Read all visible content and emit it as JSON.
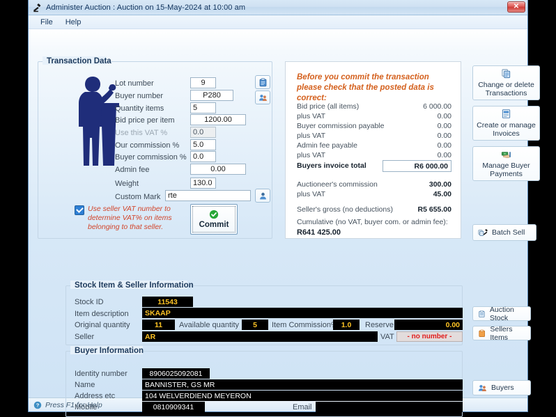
{
  "window": {
    "title": "Administer Auction : Auction on 15-May-2024 at 10:00 am",
    "icon": "gavel-icon",
    "close_label": "✕"
  },
  "menu": {
    "items": [
      {
        "label": "File"
      },
      {
        "label": "Help"
      }
    ]
  },
  "transaction": {
    "legend": "Transaction Data",
    "fields": [
      {
        "label": "Lot number",
        "value": "9",
        "align": "c",
        "disabled": false
      },
      {
        "label": "Buyer number",
        "value": "P280",
        "align": "c",
        "disabled": false
      },
      {
        "label": "Quantity items",
        "value": "5",
        "align": "l",
        "disabled": false
      },
      {
        "label": "Bid price per item",
        "value": "1200.00",
        "align": "c",
        "disabled": false
      },
      {
        "label": "Use this VAT %",
        "value": "0.0",
        "align": "l",
        "disabled": true
      },
      {
        "label": "Our commission %",
        "value": "5.0",
        "align": "l",
        "disabled": false
      },
      {
        "label": "Buyer commission %",
        "value": "0.0",
        "align": "l",
        "disabled": false
      },
      {
        "label": "Admin fee",
        "value": "0.00",
        "align": "c",
        "disabled": false
      },
      {
        "label": "Weight",
        "value": "130.0",
        "align": "l",
        "disabled": false
      },
      {
        "label": "Custom Mark",
        "value": "rte",
        "align": "l",
        "disabled": false
      }
    ],
    "vat_checkbox_text": "Use seller VAT number to determine VAT% on items belonging to that seller.",
    "vat_checkbox_checked": true,
    "commit_label": "Commit",
    "commit_icon": "green-check-icon",
    "lot_lookup_icon": "clipboard-icon",
    "buyer_lookup_icon": "people-icon",
    "custom_mark_icon": "person-icon"
  },
  "summary": {
    "heading": "Before you commit the transaction please check that the posted data is correct:",
    "rows": [
      {
        "label": "Bid price (all items)",
        "value": "6 000.00",
        "bold": false
      },
      {
        "label": "plus VAT",
        "value": "0.00",
        "bold": false
      },
      {
        "label": "Buyer commission payable",
        "value": "0.00",
        "bold": false
      },
      {
        "label": "plus VAT",
        "value": "0.00",
        "bold": false
      },
      {
        "label": "Admin fee payable",
        "value": "0.00",
        "bold": false
      },
      {
        "label": "plus VAT",
        "value": "0.00",
        "bold": false
      }
    ],
    "invoice_total_label": "Buyers invoice total",
    "invoice_total_value": "R6 000.00",
    "commission_rows": [
      {
        "label": "Auctioneer's commission",
        "value": "300.00"
      },
      {
        "label": "plus VAT",
        "value": "45.00"
      }
    ],
    "sellers_gross_label": "Seller's gross (no deductions)",
    "sellers_gross_value": "R5 655.00",
    "cumulative_label": "Cumulative (no VAT, buyer com. or admin fee):",
    "cumulative_value": "R641 425.00"
  },
  "side_buttons": [
    {
      "label": "Change or delete Transactions",
      "icon": "copy-pages-icon"
    },
    {
      "label": "Create or manage Invoices",
      "icon": "invoice-icon"
    },
    {
      "label": "Manage Buyer Payments",
      "icon": "cash-hand-icon"
    }
  ],
  "batch_sell": {
    "label": "Batch Sell",
    "icon": "stack-gavel-icon"
  },
  "stock": {
    "legend": "Stock Item & Seller Information",
    "stock_id_label": "Stock ID",
    "stock_id_value": "11543",
    "description_label": "Item description",
    "description_value": "SKAAP",
    "original_qty_label": "Original quantity",
    "original_qty_value": "11",
    "available_qty_label": "Available quantity",
    "available_qty_value": "5",
    "item_commission_label": "Item Commission%",
    "item_commission_value": "1.0",
    "reserve_label": "Reserve",
    "reserve_value": "0.00",
    "seller_label": "Seller",
    "seller_value": "AR",
    "vat_no_label": "VAT No",
    "vat_no_value": "- no number -",
    "buttons": [
      {
        "label": "Auction Stock",
        "icon": "clipboard-icon"
      },
      {
        "label": "Sellers Items",
        "icon": "orange-clipboard-icon"
      }
    ]
  },
  "buyer": {
    "legend": "Buyer Information",
    "identity_label": "Identity number",
    "identity_value": "8906025092081",
    "name_label": "Name",
    "name_value": "BANNISTER, GS MR",
    "address_label": "Address etc",
    "address_value": "104 WELVERDIEND MEYERON",
    "mobile_label": "Mobile",
    "mobile_value": "0810909341",
    "email_label": "Email",
    "email_value": "",
    "button": {
      "label": "Buyers",
      "icon": "people-icon"
    }
  },
  "status": {
    "text": "Press F1 for Help",
    "icon": "help-icon"
  }
}
